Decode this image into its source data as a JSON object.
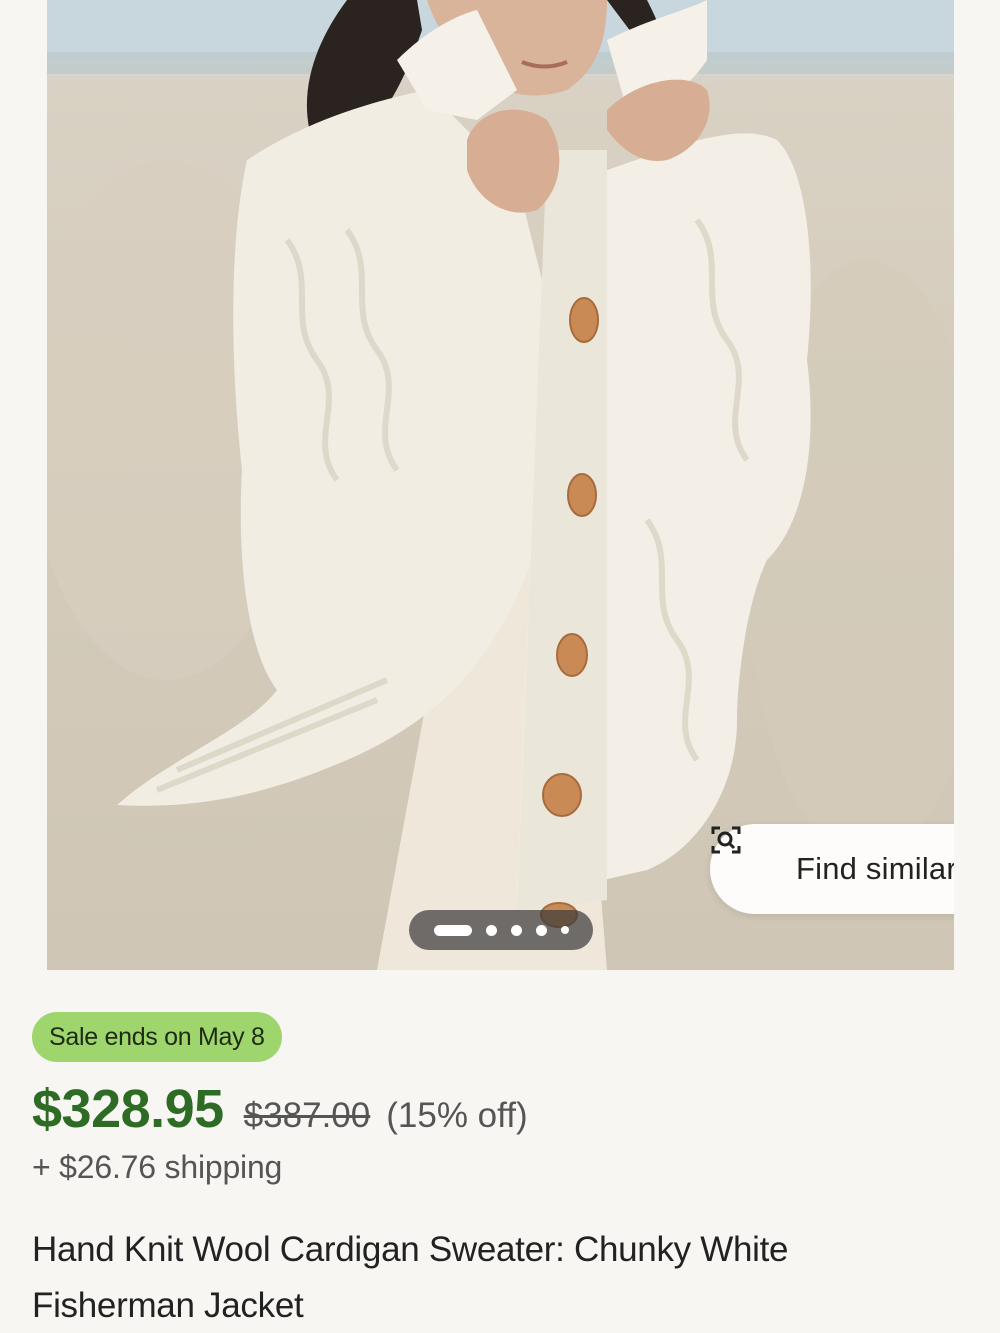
{
  "product_image": {
    "alt": "White chunky cable knit cardigan",
    "find_similar_label": "Find similar",
    "find_similar_icon": "visual-search-icon",
    "carousel": {
      "total_slides": 5,
      "active_index": 0
    }
  },
  "listing": {
    "sale_badge": "Sale ends on May 8",
    "price_current": "$328.95",
    "price_original": "$387.00",
    "discount": "(15% off)",
    "shipping": "+ $26.76 shipping",
    "title": "Hand Knit Wool Cardigan Sweater: Chunky White Fisherman Jacket"
  },
  "colors": {
    "sale_badge_bg": "#9ed56c",
    "price_green": "#2e6b25",
    "page_bg": "#f7f6f3"
  }
}
